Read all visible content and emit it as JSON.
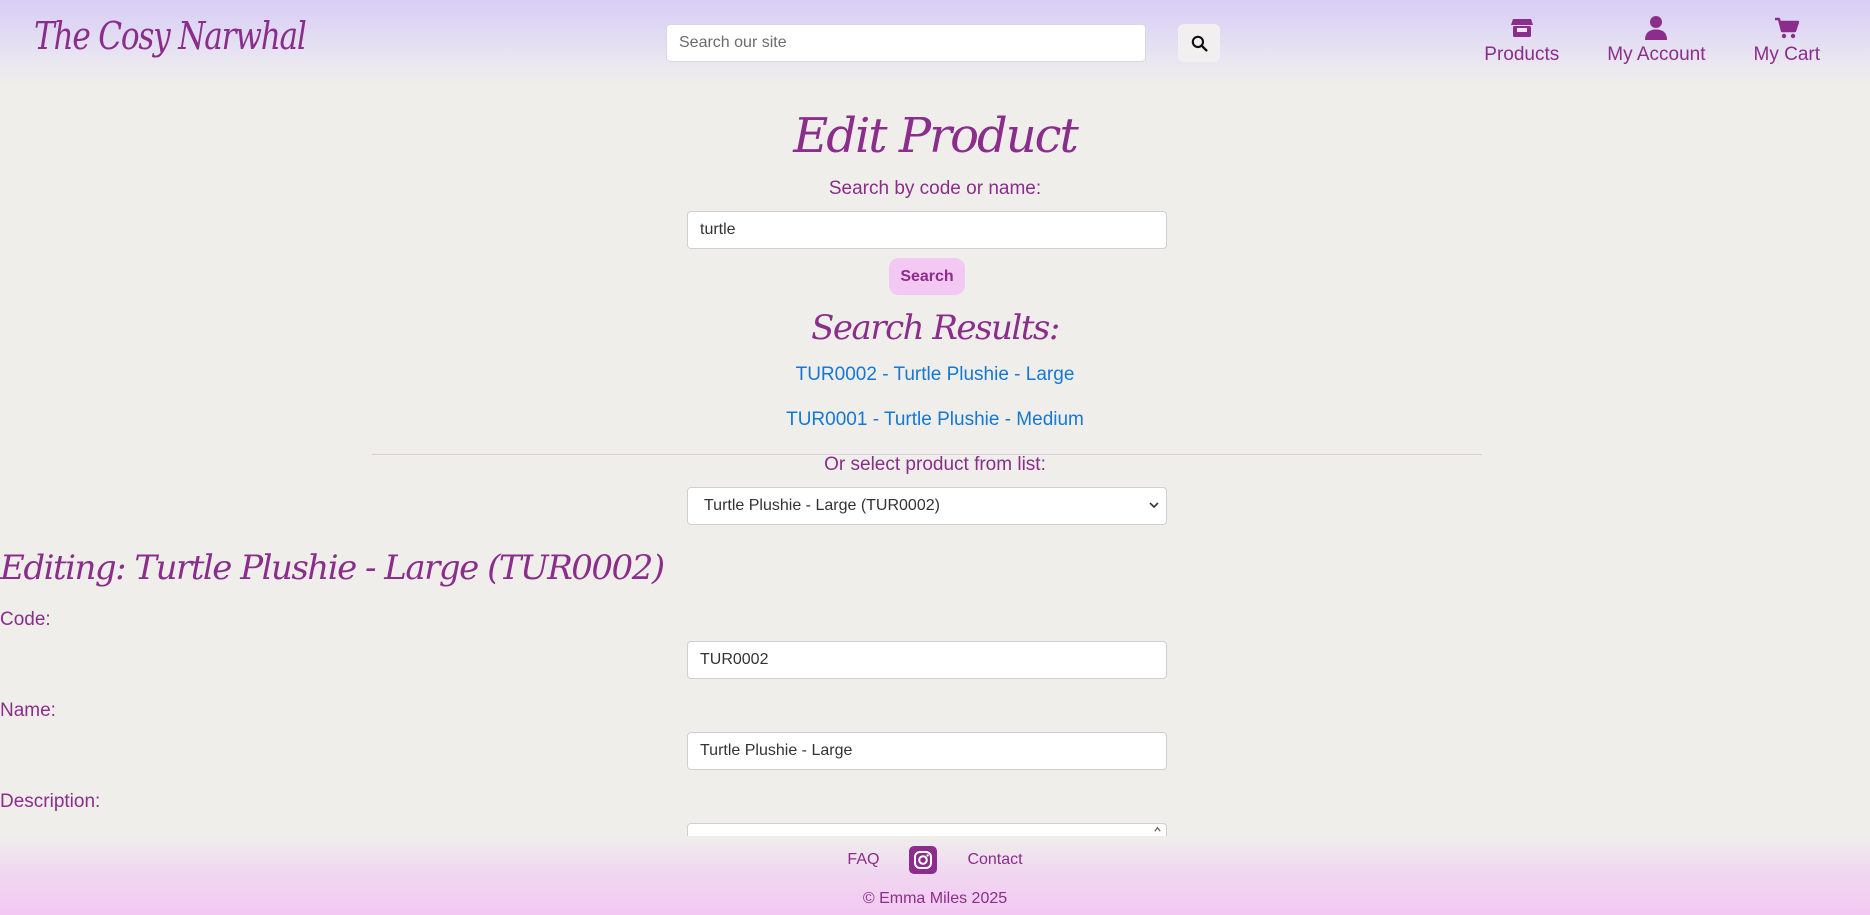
{
  "header": {
    "brand": "The Cosy Narwhal",
    "search_placeholder": "Search our site",
    "nav": [
      {
        "label": "Products",
        "icon": "store-icon"
      },
      {
        "label": "My Account",
        "icon": "user-icon"
      },
      {
        "label": "My Cart",
        "icon": "cart-icon"
      }
    ]
  },
  "main": {
    "title": "Edit Product",
    "search_label": "Search by code or name:",
    "search_value": "turtle",
    "search_button": "Search",
    "results_title": "Search Results:",
    "results": [
      "TUR0002 - Turtle Plushie - Large",
      "TUR0001 - Turtle Plushie - Medium"
    ],
    "select_label": "Or select product from list:",
    "select_value": "Turtle Plushie - Large (TUR0002)",
    "editing_title": "Editing: Turtle Plushie - Large (TUR0002)",
    "code_label": "Code:",
    "code_value": "TUR0002",
    "name_label": "Name:",
    "name_value": "Turtle Plushie - Large",
    "description_label": "Description:"
  },
  "footer": {
    "faq": "FAQ",
    "contact": "Contact",
    "copyright": "© Emma Miles 2025"
  },
  "colors": {
    "brand_purple": "#8b2d8b",
    "link_blue": "#1478d4",
    "button_pink": "#f3c8f2",
    "header_lavender": "#d7cdf6",
    "page_background": "#efeeeb"
  }
}
